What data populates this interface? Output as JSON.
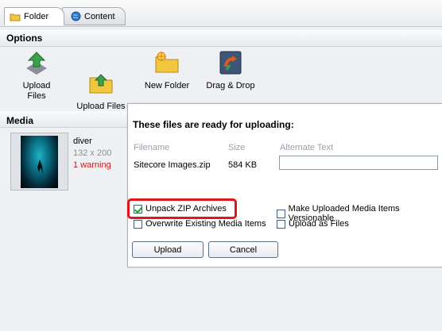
{
  "tabs": [
    {
      "label": "Folder",
      "icon": "folder-icon",
      "active": true
    },
    {
      "label": "Content",
      "icon": "globe-icon",
      "active": false
    }
  ],
  "options": {
    "header": "Options",
    "tools": [
      {
        "label": "Upload Files",
        "icon": "upload-arrow-icon"
      },
      {
        "label": "Upload Files\n(Advanced)",
        "icon": "folder-upload-icon"
      },
      {
        "label": "New Folder",
        "icon": "new-folder-icon"
      },
      {
        "label": "Drag & Drop",
        "icon": "drag-drop-icon"
      }
    ]
  },
  "media": {
    "header": "Media",
    "item": {
      "name": "diver",
      "dimensions": "132 x 200",
      "warning": "1 warning"
    }
  },
  "dialog": {
    "title": "These files are ready for uploading:",
    "columns": [
      "Filename",
      "Size",
      "Alternate Text"
    ],
    "file": {
      "name": "Sitecore Images.zip",
      "size": "584 KB",
      "alt_text": ""
    },
    "options": {
      "unpack_zip": {
        "label": "Unpack ZIP Archives",
        "checked": true
      },
      "overwrite": {
        "label": "Overwrite Existing Media Items",
        "checked": false
      },
      "versionable": {
        "label": "Make Uploaded Media Items Versionable",
        "checked": false
      },
      "upload_as_files": {
        "label": "Upload as Files",
        "checked": false
      }
    },
    "buttons": {
      "upload": "Upload",
      "cancel": "Cancel"
    }
  },
  "colors": {
    "highlight": "#e0161b",
    "warning": "#d11a1a"
  }
}
